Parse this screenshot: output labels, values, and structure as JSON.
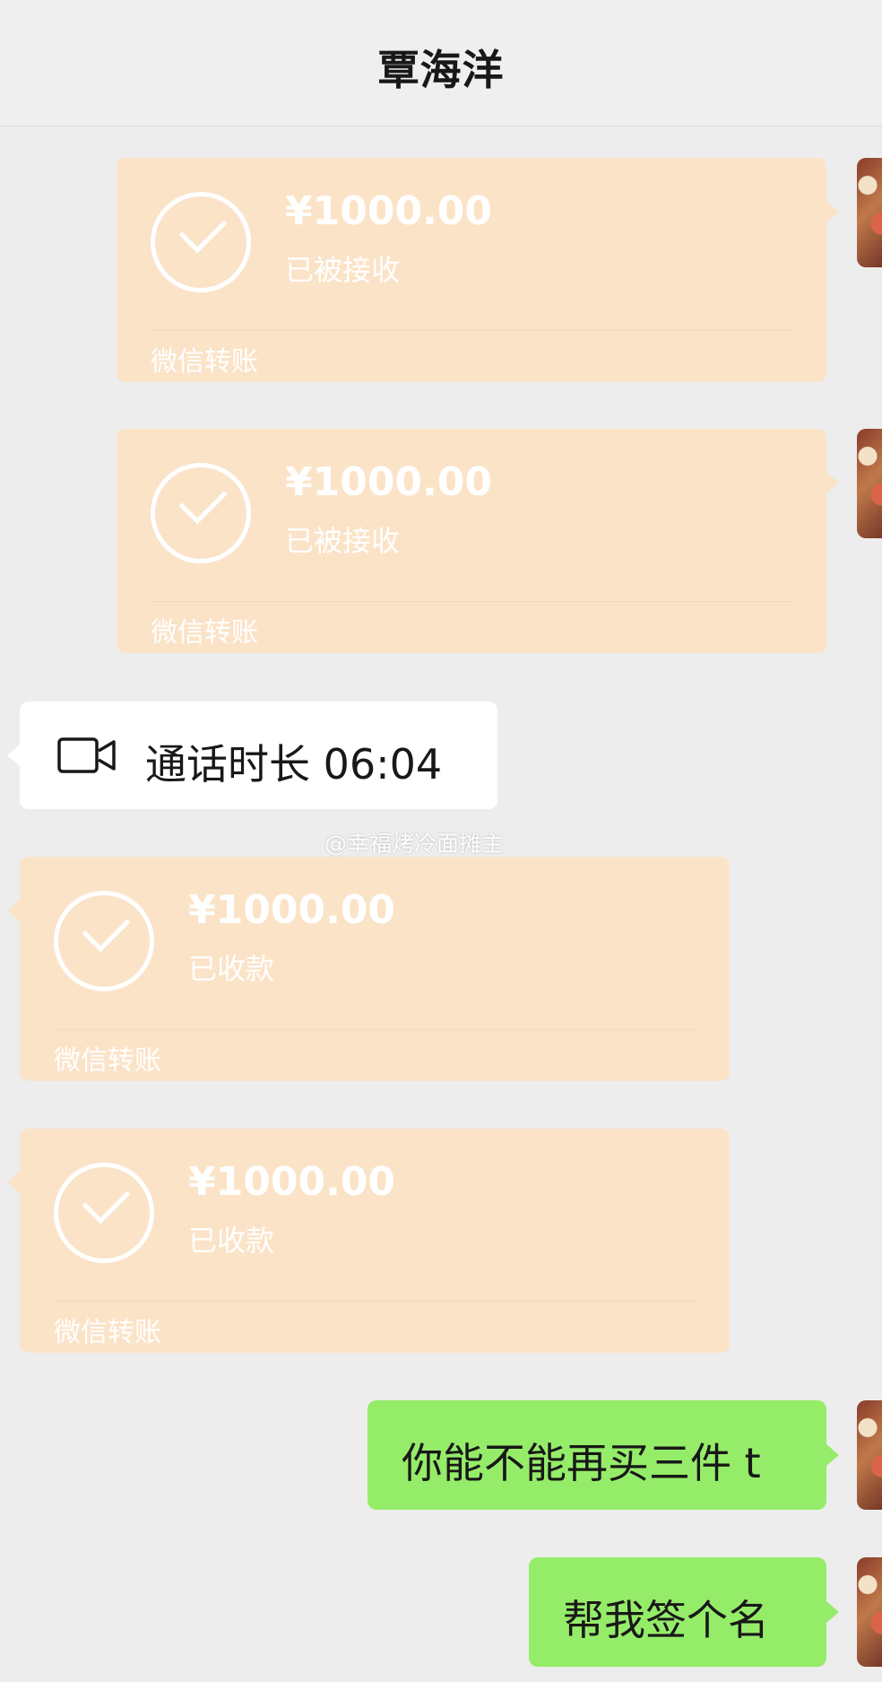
{
  "header": {
    "title": "覃海洋"
  },
  "messages": {
    "transfer_sent_1": {
      "amount": "¥1000.00",
      "status": "已被接收",
      "caption": "微信转账"
    },
    "transfer_sent_2": {
      "amount": "¥1000.00",
      "status": "已被接收",
      "caption": "微信转账"
    },
    "video_call": {
      "icon": "video-camera-icon",
      "text": "通话时长 06:04"
    },
    "transfer_received_1": {
      "amount": "¥1000.00",
      "status": "已收款",
      "caption": "微信转账"
    },
    "transfer_received_2": {
      "amount": "¥1000.00",
      "status": "已收款",
      "caption": "微信转账"
    },
    "text_sent_1": {
      "text": "你能不能再买三件 t"
    },
    "text_sent_2": {
      "text": "帮我签个名"
    }
  },
  "watermark": {
    "text": "@幸福烤冷面摊主"
  },
  "colors": {
    "background": "#ededed",
    "transfer_bubble": "#fbe3c8",
    "sent_bubble": "#95ec69",
    "received_bubble": "#ffffff"
  }
}
